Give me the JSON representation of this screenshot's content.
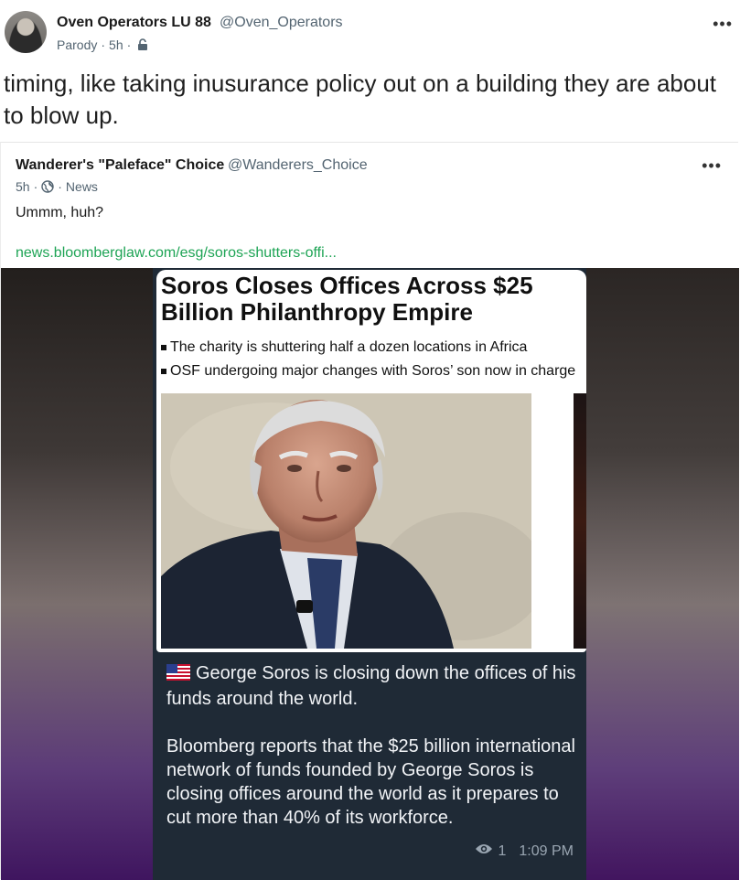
{
  "post": {
    "author_name": "Oven Operators LU 88",
    "author_handle": "@Oven_Operators",
    "label": "Parody",
    "time": "5h",
    "separator": "·",
    "text": "timing, like taking inusurance policy out on a building they are about to blow up.",
    "icons": {
      "more": "more-icon",
      "visibility": "lock-icon"
    }
  },
  "quote": {
    "author_name": "Wanderer's \"Paleface\" Choice",
    "author_handle": "@Wanderers_Choice",
    "time": "5h",
    "separator": "·",
    "category": "News",
    "text": "Ummm, huh?",
    "link_text": "news.bloomberglaw.com/esg/soros-shutters-offi...",
    "icons": {
      "more": "more-icon",
      "visibility": "globe-icon"
    }
  },
  "media": {
    "article_title": "Soros Closes Offices Across $25 Billion Philanthropy Empire",
    "bullets": [
      "The charity is shuttering half a dozen locations in Africa",
      "OSF undergoing major changes with Soros’ son now in charge"
    ],
    "message_line1": "George Soros is closing down the offices of his funds around the world.",
    "message_line2": "Bloomberg reports that the $25 billion international network of funds founded by George Soros is closing offices around the world as it prepares to cut more than 40% of its workforce.",
    "views": "1",
    "time": "1:09 PM"
  },
  "colors": {
    "link": "#1ea455",
    "muted": "#536471",
    "phone_bg": "#1f2a36"
  }
}
